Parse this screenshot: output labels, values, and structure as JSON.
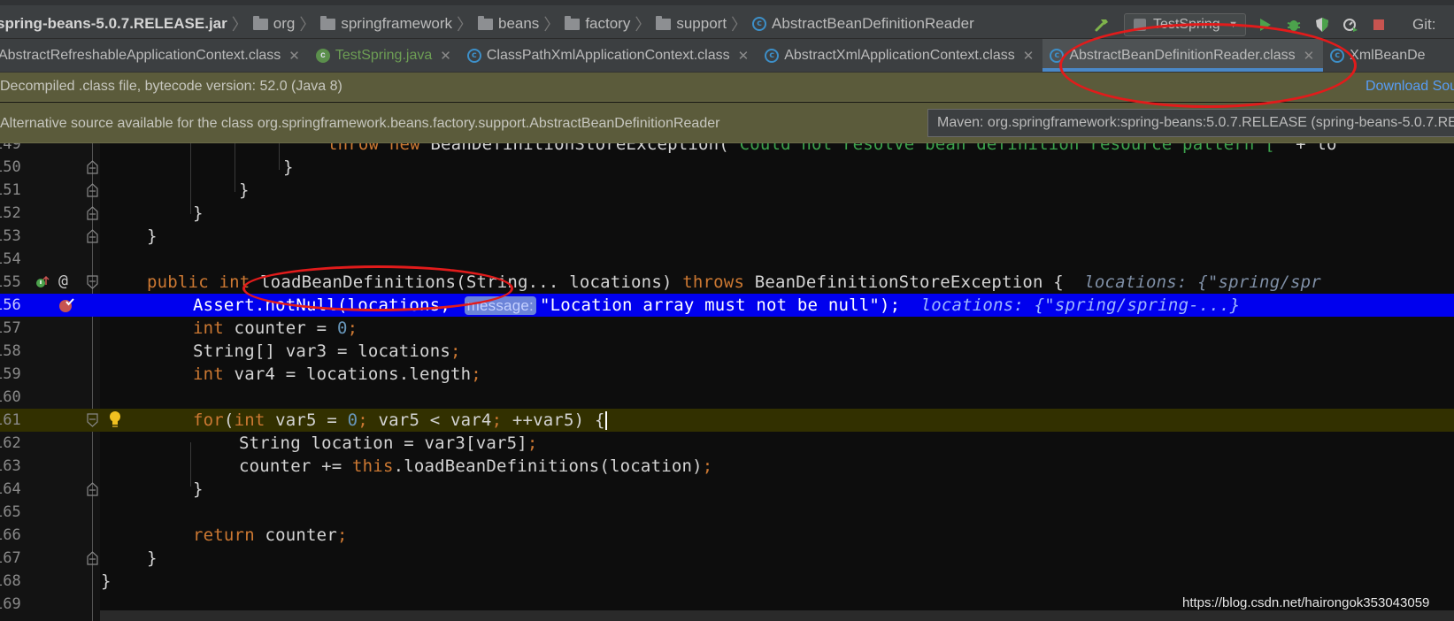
{
  "breadcrumb": {
    "items": [
      "spring-beans-5.0.7.RELEASE.jar",
      "org",
      "springframework",
      "beans",
      "factory",
      "support",
      "AbstractBeanDefinitionReader"
    ]
  },
  "toolbar": {
    "run_config": "TestSpring",
    "git_label": "Git:"
  },
  "tabs": [
    {
      "label": "AbstractRefreshableApplicationContext.class",
      "type": "class",
      "active": false
    },
    {
      "label": "TestSpring.java",
      "type": "java",
      "active": false
    },
    {
      "label": "ClassPathXmlApplicationContext.class",
      "type": "class",
      "active": false
    },
    {
      "label": "AbstractXmlApplicationContext.class",
      "type": "class",
      "active": false
    },
    {
      "label": "AbstractBeanDefinitionReader.class",
      "type": "class",
      "active": true
    },
    {
      "label": "XmlBeanDe",
      "type": "class",
      "active": false
    }
  ],
  "banner_decompiled": {
    "text": "Decompiled .class file, bytecode version: 52.0 (Java 8)",
    "link": "Download Sou"
  },
  "banner_alternative": {
    "text": "Alternative source available for the class org.springframework.beans.factory.support.AbstractBeanDefinitionReader",
    "maven_option": "Maven: org.springframework:spring-beans:5.0.7.RELEASE (spring-beans-5.0.7.REL"
  },
  "editor": {
    "line_numbers": [
      "149",
      "150",
      "151",
      "152",
      "153",
      "154",
      "155",
      "156",
      "157",
      "158",
      "159",
      "160",
      "161",
      "162",
      "163",
      "164",
      "165",
      "166",
      "167",
      "168",
      "169"
    ],
    "param_hint": "message:",
    "code": {
      "l149_kw1": "throw",
      "l149_kw2": "new",
      "l149_cls": " BeanDefinitionStoreException(",
      "l149_str": "\"Could not resolve bean definition resource pattern [\"",
      "l149_rest": " + lo",
      "l150": "}",
      "l151": "}",
      "l152": "}",
      "l153": "}",
      "l155_kw1": "public",
      "l155_kw2": "int",
      "l155_mid": " loadBeanDefinitions(String... locations) ",
      "l155_kw3": "throws",
      "l155_rest": " BeanDefinitionStoreException {",
      "l155_hint": "locations: {\"spring/spr",
      "l156_a": "Assert.notNull(locations, ",
      "l156_str": "\"Location array must not be null\"",
      "l156_b": ");",
      "l156_hint": "locations: {\"spring/spring-...}",
      "l157_kw": "int",
      "l157_a": " counter = ",
      "l157_num": "0",
      "l157_b": ";",
      "l158_a": "String[] var3 = locations",
      "l158_b": ";",
      "l159_kw": "int",
      "l159_a": " var4 = locations.length",
      "l159_b": ";",
      "l161_kw1": "for",
      "l161_a": "(",
      "l161_kw2": "int",
      "l161_b": " var5 = ",
      "l161_num": "0",
      "l161_c": "; ",
      "l161_d": "var5 < var4",
      "l161_e": "; ",
      "l161_f": "++var5) {",
      "l162_a": "String location = var3[var5]",
      "l162_b": ";",
      "l163_a": "counter += ",
      "l163_kw": "this",
      "l163_b": ".loadBeanDefinitions(location)",
      "l163_c": ";",
      "l164": "}",
      "l166_kw": "return",
      "l166_a": " counter",
      "l166_b": ";",
      "l167": "}",
      "l168": "}"
    }
  },
  "watermark": "https://blog.csdn.net/hairongok353043059",
  "colors": {
    "execution_line": "#0000ee",
    "current_line": "#323000",
    "keyword": "#cc7832",
    "string": "#3ca34c",
    "number": "#6897bb",
    "annotation": "#e21b1b"
  }
}
